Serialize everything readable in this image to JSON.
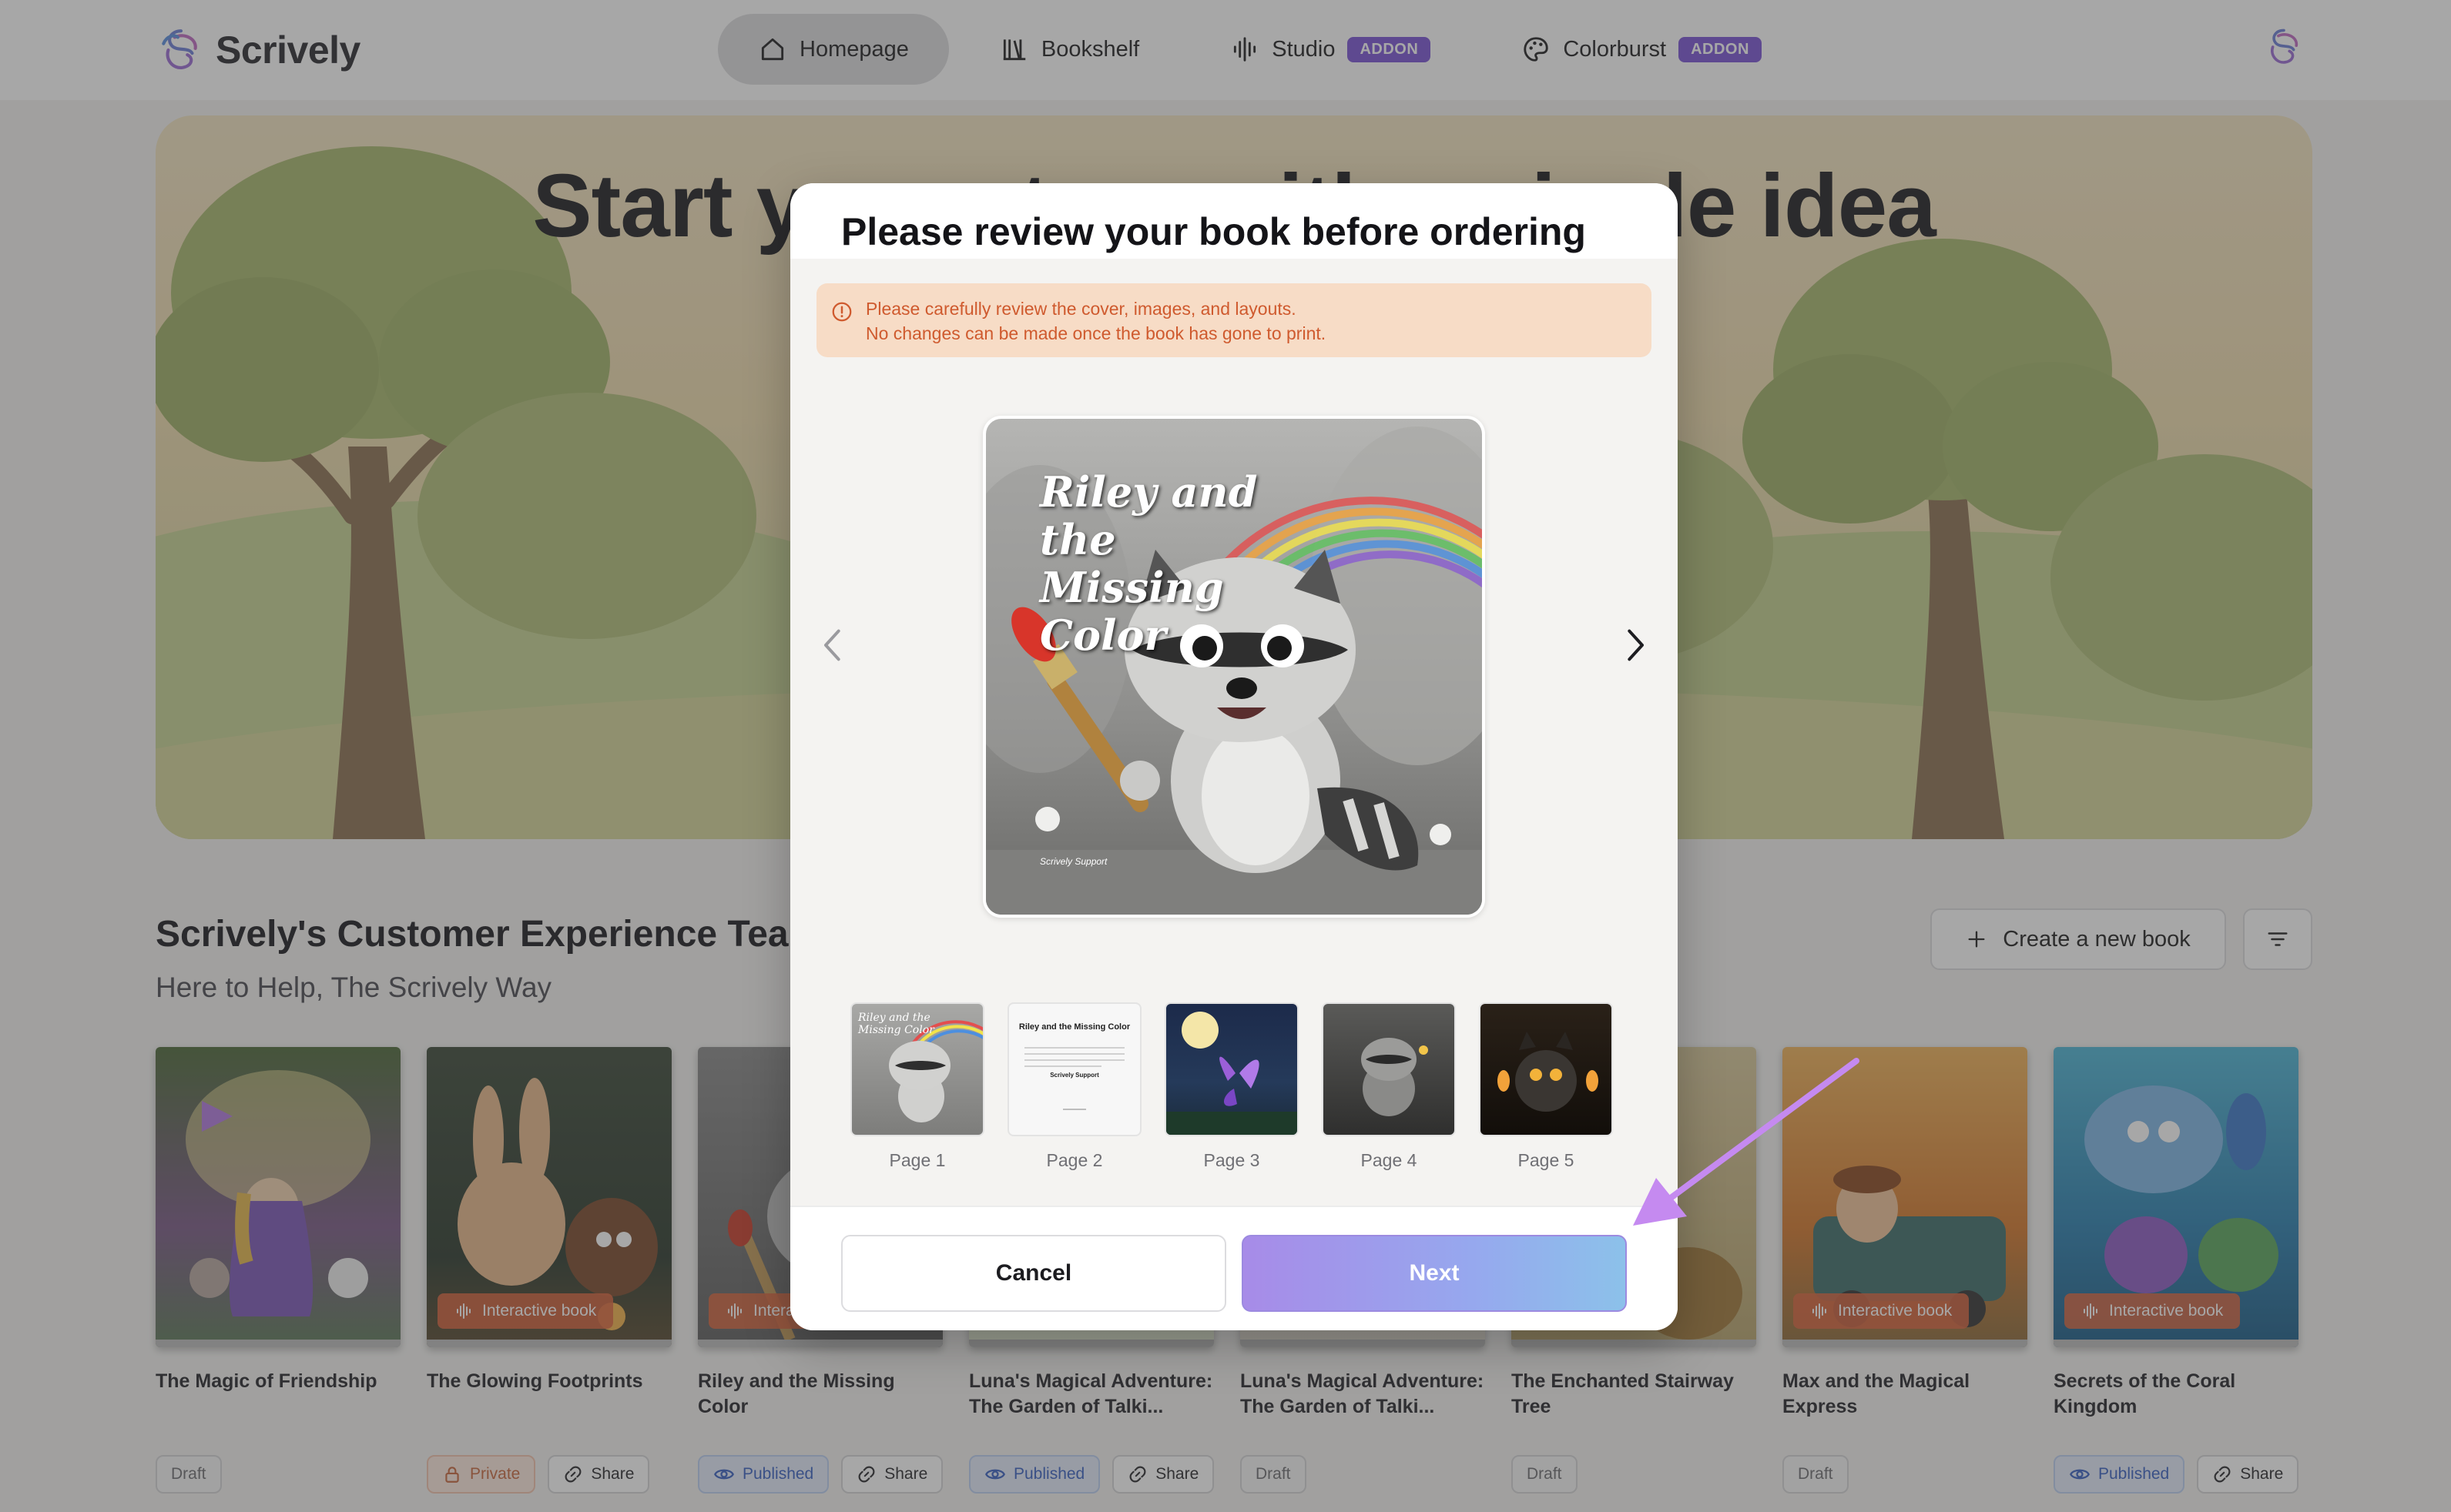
{
  "app": {
    "name": "Scrively"
  },
  "nav": {
    "items": [
      {
        "label": "Homepage",
        "icon": "home-icon",
        "active": true,
        "addon": ""
      },
      {
        "label": "Bookshelf",
        "icon": "books-icon",
        "active": false,
        "addon": ""
      },
      {
        "label": "Studio",
        "icon": "audio-wave-icon",
        "active": false,
        "addon": "ADDON"
      },
      {
        "label": "Colorburst",
        "icon": "palette-icon",
        "active": false,
        "addon": "ADDON"
      }
    ]
  },
  "hero": {
    "title": "Start your story with a single idea"
  },
  "section": {
    "title": "Scrively's Customer Experience Team",
    "subtitle": "Here to Help, The Scrively Way",
    "create_label": "Create a new book"
  },
  "books": [
    {
      "title": "The Magic of Friendship",
      "status": "Draft",
      "interactive": false,
      "share": ""
    },
    {
      "title": "The Glowing Footprints",
      "status": "Private",
      "interactive": true,
      "share": "Share",
      "tag": "Interactive book"
    },
    {
      "title": "Riley and the Missing Color",
      "status": "Published",
      "interactive": true,
      "share": "Share",
      "tag": "Interactive book"
    },
    {
      "title": "Luna's Magical Adventure: The Garden of Talki...",
      "status": "Published",
      "interactive": false,
      "share": "Share"
    },
    {
      "title": "Luna's Magical Adventure: The Garden of Talki...",
      "status": "Draft",
      "interactive": false,
      "share": ""
    },
    {
      "title": "The Enchanted Stairway Tree",
      "status": "Draft",
      "interactive": false,
      "share": ""
    },
    {
      "title": "Max and the Magical Express",
      "status": "Draft",
      "interactive": true,
      "share": "",
      "tag": "Interactive book"
    },
    {
      "title": "Secrets of the Coral Kingdom",
      "status": "Published",
      "interactive": true,
      "share": "Share",
      "tag": "Interactive book"
    }
  ],
  "modal": {
    "title": "Please review your book before ordering",
    "warning_line1": "Please carefully review the cover, images, and layouts.",
    "warning_line2": "No changes can be made once the book has gone to print.",
    "cover_title": "Riley and the Missing Color",
    "cover_credit": "Scrively Support",
    "page2_title": "Riley and the Missing Color",
    "page2_credit": "Scrively Support",
    "pages": [
      "Page 1",
      "Page 2",
      "Page 3",
      "Page 4",
      "Page 5"
    ],
    "cancel_label": "Cancel",
    "next_label": "Next"
  },
  "colors": {
    "accent": "#7b55d6",
    "warning_bg": "#f7dcc6",
    "warning_text": "#cf5a2e",
    "next_gradient_start": "#a78be8",
    "next_gradient_end": "#8cc1ea"
  }
}
